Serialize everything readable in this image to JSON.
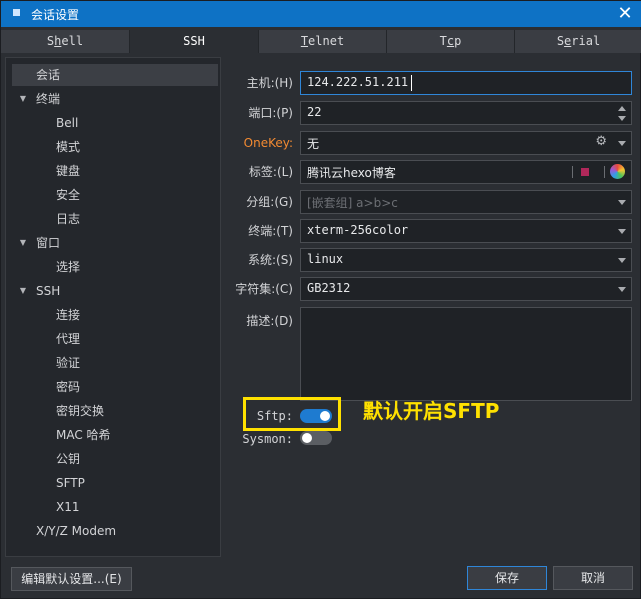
{
  "window": {
    "title": "会话设置"
  },
  "tabs": [
    {
      "pre": "S",
      "u": "h",
      "post": "ell"
    },
    {
      "pre": "",
      "u": "",
      "post": "SSH"
    },
    {
      "pre": "",
      "u": "T",
      "post": "elnet"
    },
    {
      "pre": "T",
      "u": "c",
      "post": "p"
    },
    {
      "pre": "S",
      "u": "e",
      "post": "rial"
    }
  ],
  "tree": {
    "session": "会话",
    "terminal": "终端",
    "bell": "Bell",
    "mode": "模式",
    "keyboard": "键盘",
    "security": "安全",
    "log": "日志",
    "window": "窗口",
    "select": "选择",
    "ssh": "SSH",
    "connection": "连接",
    "proxy": "代理",
    "auth": "验证",
    "password": "密码",
    "kex": "密钥交换",
    "mac": "MAC 哈希",
    "pubkey": "公钥",
    "sftp": "SFTP",
    "x11": "X11",
    "xyz": "X/Y/Z Modem"
  },
  "form": {
    "host_label": "主机:(H)",
    "host_value": "124.222.51.211",
    "port_label": "端口:(P)",
    "port_value": "22",
    "onekey_label": "OneKey:",
    "onekey_value": "无",
    "tag_label": "标签:(L)",
    "tag_value": "腾讯云hexo博客",
    "group_label": "分组:(G)",
    "group_placeholder": "[嵌套组] a>b>c",
    "terminal_label": "终端:(T)",
    "terminal_value": "xterm-256color",
    "system_label": "系统:(S)",
    "system_value": "linux",
    "charset_label": "字符集:(C)",
    "charset_value": "GB2312",
    "desc_label": "描述:(D)",
    "sftp_label": "Sftp:",
    "sftp_on": true,
    "sysmon_label": "Sysmon:",
    "sysmon_on": false
  },
  "annotation": "默认开启SFTP",
  "buttons": {
    "edit_default": "编辑默认设置...(E)",
    "save": "保存",
    "cancel": "取消"
  },
  "colors": {
    "titlebar": "#0e72c5",
    "accent": "#1e7bd0",
    "annotation": "#ffe100",
    "onekey_label": "#f28a32"
  }
}
